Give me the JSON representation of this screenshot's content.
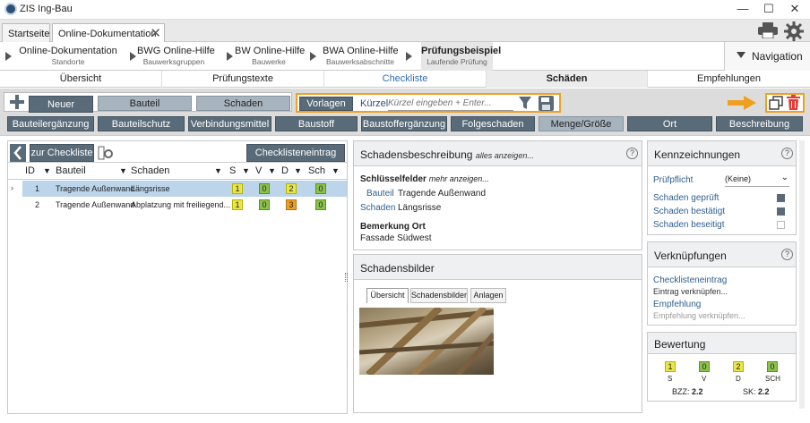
{
  "window": {
    "title": "ZIS Ing-Bau",
    "minimize": "—",
    "maximize": "☐",
    "close": "✕"
  },
  "doc_tabs": [
    {
      "label": "Startseite"
    },
    {
      "label": "Online-Dokumentation"
    }
  ],
  "breadcrumbs": [
    {
      "title": "Online-Dokumentation",
      "sub": "Standorte"
    },
    {
      "title": "BWG Online-Hilfe",
      "sub": "Bauwerksgruppen"
    },
    {
      "title": "BW Online-Hilfe",
      "sub": "Bauwerke"
    },
    {
      "title": "BWA Online-Hilfe",
      "sub": "Bauwerksabschnitte"
    },
    {
      "title": "Prüfungsbeispiel",
      "sub": "Laufende Prüfung"
    }
  ],
  "navigation_label": "Navigation",
  "main_tabs": [
    "Übersicht",
    "Prüfungstexte",
    "Checkliste",
    "Schäden",
    "Empfehlungen"
  ],
  "toolbar": {
    "new_damage": "Neuer Schaden",
    "bauteil": "Bauteil",
    "schaden": "Schaden",
    "vorlagen": "Vorlagen",
    "kuerzel": "Kürzel",
    "kuerzel_placeholder": "Kürzel eingeben + Enter...",
    "row2": [
      "Bauteilergänzung",
      "Bauteilschutz",
      "Verbindungsmittel",
      "Baustoff",
      "Baustoffergänzung",
      "Folgeschaden",
      "Menge/Größe",
      "Ort",
      "Beschreibung"
    ]
  },
  "left": {
    "back_label": "zur Checkliste",
    "filter_label": "Checklisteneintrag filtern",
    "columns": [
      "ID",
      "Bauteil",
      "Schaden",
      "S",
      "V",
      "D",
      "Sch"
    ],
    "rows": [
      {
        "id": "1",
        "bauteil": "Tragende Außenwand",
        "schaden": "Längsrisse",
        "s": "1",
        "v": "0",
        "d": "2",
        "sch": "0"
      },
      {
        "id": "2",
        "bauteil": "Tragende Außenwand",
        "schaden": "Abplatzung mit freiliegend...",
        "s": "1",
        "v": "0",
        "d": "3",
        "sch": "0"
      }
    ]
  },
  "middle": {
    "title": "Schadensbeschreibung",
    "show_all": "alles anzeigen...",
    "keyfields": "Schlüsselfelder",
    "more": "mehr anzeigen...",
    "bauteil_label": "Bauteil",
    "bauteil_value": "Tragende Außenwand",
    "schaden_label": "Schaden",
    "schaden_value": "Längsrisse",
    "remark_title": "Bemerkung Ort",
    "remark_value": "Fassade Südwest",
    "images_title": "Schadensbilder",
    "image_tabs": [
      "Übersicht",
      "Schadensbilder",
      "Anlagen"
    ]
  },
  "right": {
    "kennz_title": "Kennzeichnungen",
    "pruefpflicht_label": "Prüfpflicht",
    "pruefpflicht_value": "(Keine)",
    "checks": [
      {
        "label": "Schaden geprüft",
        "checked": true
      },
      {
        "label": "Schaden bestätigt",
        "checked": true
      },
      {
        "label": "Schaden beseitigt",
        "checked": false
      }
    ],
    "links_title": "Verknüpfungen",
    "links": [
      {
        "title": "Checklisteneintrag",
        "sub": "Eintrag verknüpfen..."
      },
      {
        "title": "Empfehlung",
        "sub": "Empfehlung verknüpfen..."
      }
    ],
    "bew_title": "Bewertung",
    "scores": [
      {
        "label": "S",
        "value": "1"
      },
      {
        "label": "V",
        "value": "0"
      },
      {
        "label": "D",
        "value": "2"
      },
      {
        "label": "SCH",
        "value": "0"
      }
    ],
    "bzz_label": "BZZ:",
    "bzz_value": "2.2",
    "sk_label": "SK:",
    "sk_value": "2.2"
  },
  "colors": {
    "yellow": "#e8e64a",
    "green": "#8bc34a",
    "orange": "#f0a020",
    "accent": "#f0a020",
    "dark": "#596a78"
  }
}
